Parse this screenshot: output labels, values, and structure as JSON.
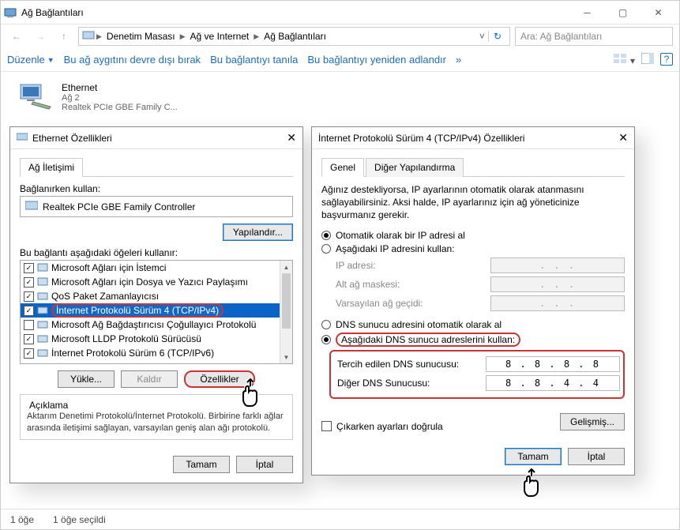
{
  "window": {
    "title": "Ağ Bağlantıları",
    "breadcrumb": [
      "Denetim Masası",
      "Ağ ve Internet",
      "Ağ Bağlantıları"
    ],
    "search_placeholder": "Ara: Ağ Bağlantıları",
    "toolbar": {
      "organize": "Düzenle",
      "disable": "Bu ağ aygıtını devre dışı bırak",
      "diagnose": "Bu bağlantıyı tanıla",
      "rename": "Bu bağlantıyı yeniden adlandır"
    },
    "connection": {
      "name": "Ethernet",
      "network": "Ağ  2",
      "adapter": "Realtek PCIe GBE Family C..."
    }
  },
  "eth_dialog": {
    "title": "Ethernet Özellikleri",
    "tab_net": "Ağ İletişimi",
    "connect_using": "Bağlanırken kullan:",
    "adapter": "Realtek PCIe GBE Family Controller",
    "configure": "Yapılandır...",
    "items_label": "Bu bağlantı aşağıdaki öğeleri kullanır:",
    "items": [
      {
        "checked": true,
        "label": "Microsoft Ağları için İstemci"
      },
      {
        "checked": true,
        "label": "Microsoft Ağları için Dosya ve Yazıcı Paylaşımı"
      },
      {
        "checked": true,
        "label": "QoS Paket Zamanlayıcısı"
      },
      {
        "checked": true,
        "label": "İnternet Protokolü Sürüm 4 (TCP/IPv4)"
      },
      {
        "checked": false,
        "label": "Microsoft Ağ Bağdaştırıcısı Çoğullayıcı Protokolü"
      },
      {
        "checked": true,
        "label": "Microsoft LLDP Protokolü Sürücüsü"
      },
      {
        "checked": true,
        "label": "İnternet Protokolü Sürüm 6 (TCP/IPv6)"
      }
    ],
    "install": "Yükle...",
    "uninstall": "Kaldır",
    "properties": "Özellikler",
    "desc_title": "Açıklama",
    "desc_text": "Aktarım Denetimi Protokolü/İnternet Protokolü. Birbirine farklı ağlar arasında iletişimi sağlayan, varsayılan geniş alan ağı protokolü.",
    "ok": "Tamam",
    "cancel": "İptal"
  },
  "ipv4_dialog": {
    "title": "İnternet Protokolü Sürüm 4 (TCP/IPv4) Özellikleri",
    "tab_general": "Genel",
    "tab_alt": "Diğer Yapılandırma",
    "helptext": "Ağınız destekliyorsa, IP ayarlarının otomatik olarak atanmasını sağlayabilirsiniz. Aksi halde, IP ayarlarınız için ağ yöneticinize başvurmanız gerekir.",
    "ip_auto": "Otomatik olarak bir IP adresi al",
    "ip_manual": "Aşağıdaki IP adresini kullan:",
    "ip_addr": "IP adresi:",
    "subnet": "Alt ağ maskesi:",
    "gateway": "Varsayılan ağ geçidi:",
    "dns_auto": "DNS sunucu adresini otomatik olarak al",
    "dns_manual": "Aşağıdaki DNS sunucu adreslerini kullan:",
    "dns_pref": "Tercih edilen DNS sunucusu:",
    "dns_alt": "Diğer DNS Sunucusu:",
    "dns_pref_val": "8 . 8 . 8 . 8",
    "dns_alt_val": "8 . 8 . 4 . 4",
    "validate": "Çıkarken ayarları doğrula",
    "advanced": "Gelişmiş...",
    "ok": "Tamam",
    "cancel": "İptal"
  },
  "statusbar": {
    "count": "1 öğe",
    "selected": "1 öğe seçildi"
  }
}
